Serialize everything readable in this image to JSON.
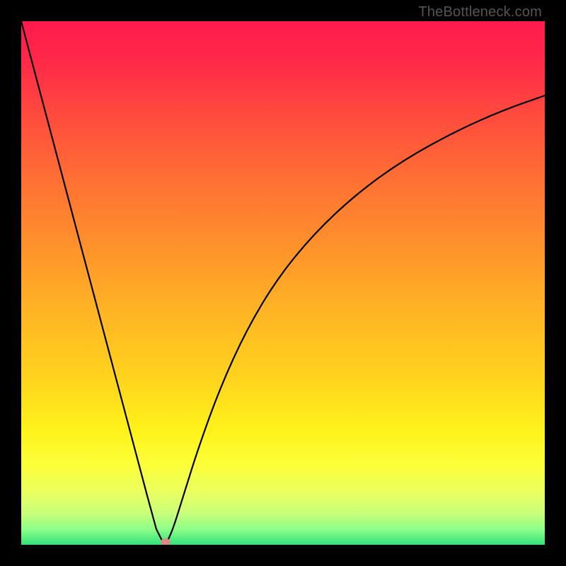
{
  "watermark": "TheBottleneck.com",
  "gradient": {
    "stops": [
      {
        "offset": 0.0,
        "color": "#ff1a4d"
      },
      {
        "offset": 0.08,
        "color": "#ff2a48"
      },
      {
        "offset": 0.18,
        "color": "#ff4b3d"
      },
      {
        "offset": 0.3,
        "color": "#ff6f34"
      },
      {
        "offset": 0.42,
        "color": "#ff8f2c"
      },
      {
        "offset": 0.55,
        "color": "#ffb324"
      },
      {
        "offset": 0.68,
        "color": "#ffd31e"
      },
      {
        "offset": 0.78,
        "color": "#fff21a"
      },
      {
        "offset": 0.85,
        "color": "#fbff3a"
      },
      {
        "offset": 0.9,
        "color": "#eaff60"
      },
      {
        "offset": 0.94,
        "color": "#c9ff7a"
      },
      {
        "offset": 0.97,
        "color": "#8eff88"
      },
      {
        "offset": 1.0,
        "color": "#33e07a"
      }
    ]
  },
  "chart_data": {
    "type": "line",
    "title": "",
    "xlabel": "",
    "ylabel": "",
    "xlim": [
      0,
      1
    ],
    "ylim": [
      0,
      1
    ],
    "series": [
      {
        "name": "left-branch",
        "x": [
          0.0,
          0.03,
          0.06,
          0.09,
          0.12,
          0.15,
          0.18,
          0.21,
          0.24,
          0.258,
          0.268,
          0.276
        ],
        "y": [
          1.0,
          0.887,
          0.774,
          0.661,
          0.548,
          0.435,
          0.322,
          0.209,
          0.096,
          0.03,
          0.01,
          0.0
        ]
      },
      {
        "name": "right-branch",
        "x": [
          0.276,
          0.29,
          0.31,
          0.34,
          0.38,
          0.43,
          0.49,
          0.56,
          0.64,
          0.73,
          0.83,
          0.92,
          1.0
        ],
        "y": [
          0.0,
          0.03,
          0.095,
          0.19,
          0.3,
          0.41,
          0.51,
          0.595,
          0.67,
          0.735,
          0.79,
          0.83,
          0.858
        ]
      }
    ],
    "marker": {
      "x": 0.276,
      "y": 0.005
    }
  }
}
